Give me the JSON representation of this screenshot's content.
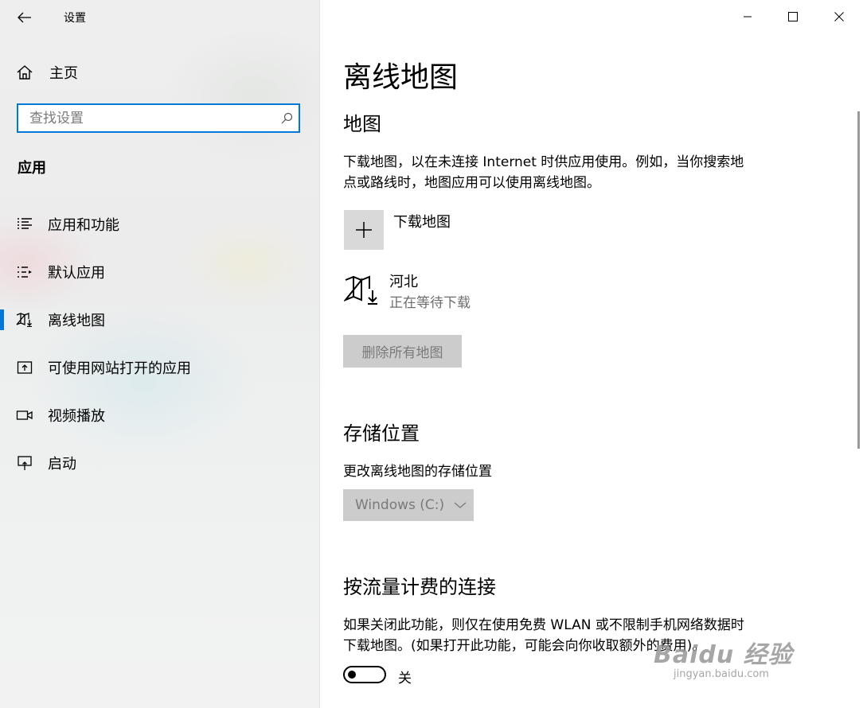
{
  "window": {
    "title": "设置",
    "controls": {
      "minimize": "minimize-icon",
      "maximize": "maximize-icon",
      "close": "close-icon"
    }
  },
  "sidebar": {
    "home_label": "主页",
    "search_placeholder": "查找设置",
    "section_title": "应用",
    "items": [
      {
        "label": "应用和功能",
        "icon": "apps-list-icon",
        "active": false
      },
      {
        "label": "默认应用",
        "icon": "default-apps-icon",
        "active": false
      },
      {
        "label": "离线地图",
        "icon": "offline-map-icon",
        "active": true
      },
      {
        "label": "可使用网站打开的应用",
        "icon": "open-with-website-icon",
        "active": false
      },
      {
        "label": "视频播放",
        "icon": "video-icon",
        "active": false
      },
      {
        "label": "启动",
        "icon": "startup-icon",
        "active": false
      }
    ]
  },
  "main": {
    "page_title": "离线地图",
    "maps": {
      "heading": "地图",
      "description_line1": "下载地图，以在未连接 Internet 时供应用使用。例如，当你搜索地",
      "description_line2": "点或路线时，地图应用可以使用离线地图。",
      "download_label": "下载地图",
      "item": {
        "name": "河北",
        "status": "正在等待下载"
      },
      "delete_all_label": "删除所有地图"
    },
    "storage": {
      "heading": "存储位置",
      "label": "更改离线地图的存储位置",
      "selected": "Windows (C:)"
    },
    "metered": {
      "heading": "按流量计费的连接",
      "description_line1": "如果关闭此功能，则仅在使用免费 WLAN 或不限制手机网络数据时",
      "description_line2": "下载地图。(如果打开此功能，可能会向你收取额外的费用)。",
      "toggle_state": "关",
      "toggle_on": false
    }
  },
  "watermark": {
    "brand": "Baidu 经验",
    "url": "jingyan.baidu.com"
  },
  "colors": {
    "accent": "#0078d7",
    "disabled_bg": "#cccccc",
    "disabled_text": "#7a7a7a"
  }
}
